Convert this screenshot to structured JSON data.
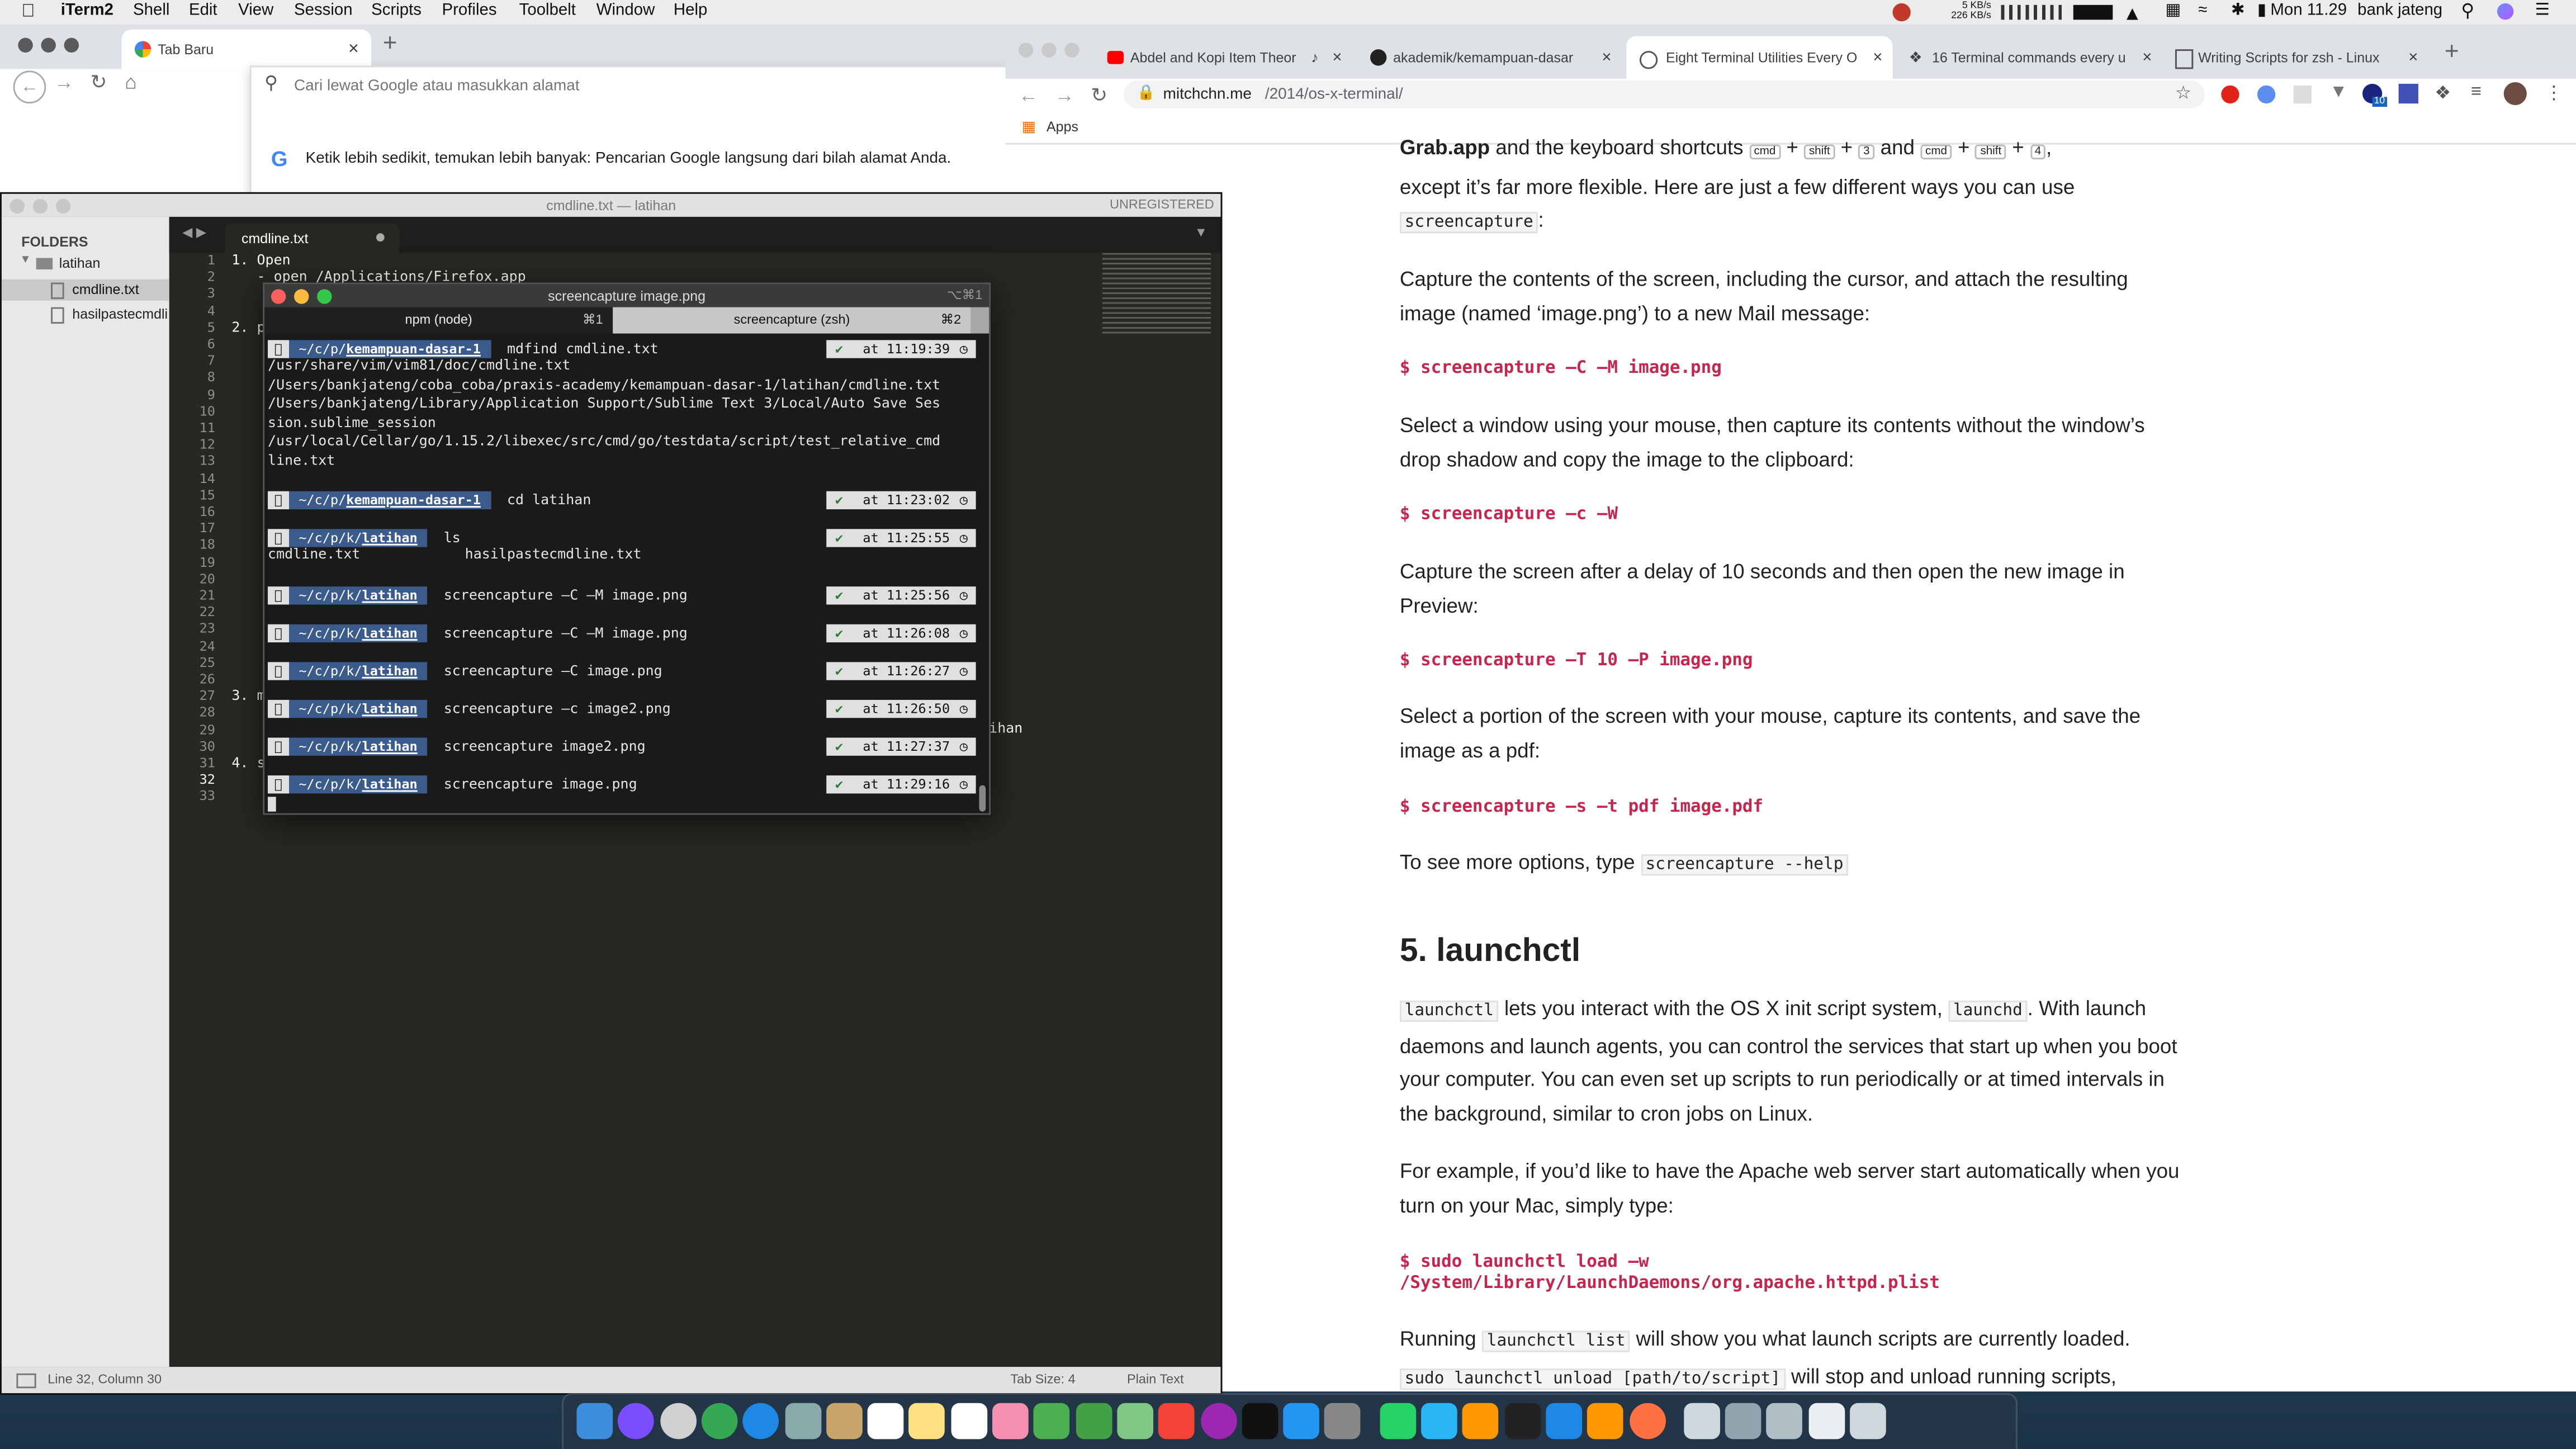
{
  "menubar": {
    "app": "iTerm2",
    "items": [
      "Shell",
      "Edit",
      "View",
      "Session",
      "Scripts",
      "Profiles",
      "Toolbelt",
      "Window",
      "Help"
    ],
    "net_up": "5 KB/s",
    "net_down": "226 KB/s",
    "clock": "Mon 11.29",
    "user": "bank jateng"
  },
  "browser_left": {
    "tab_title": "Tab Baru",
    "omnibox_placeholder": "Cari lewat Google atau masukkan alamat",
    "suggestion_text": "Ketik lebih sedikit, temukan lebih banyak: Pencarian Google langsung dari bilah alamat Anda."
  },
  "browser_right": {
    "tabs": [
      "Abdel and Kopi Item Theor",
      "akademik/kemampuan-dasar",
      "Eight Terminal Utilities Every O",
      "16 Terminal commands every u",
      "Writing Scripts for zsh - Linux"
    ],
    "url_domain": "mitchchn.me",
    "url_path": "/2014/os-x-terminal/",
    "bookmark_apps": "Apps",
    "ext_badge": "10"
  },
  "article": {
    "p1_lead": "Grab.app",
    "p1_mid": " and the keyboard shortcuts ",
    "k_cmd": "cmd",
    "k_shift": "shift",
    "k_3": "3",
    "and": "and",
    "k_4": "4",
    "p1_rest": "except it’s far more flexible. Here are just a few different ways you can use",
    "p1_code": "screencapture",
    "p1_end": ":",
    "p2": "Capture the contents of the screen, including the cursor, and attach the resulting image (named ‘image.png’) to a new Mail message:",
    "c1": "$ screencapture –C –M image.png",
    "p3": "Select a window using your mouse, then capture its contents without the window’s drop shadow and copy the image to the clipboard:",
    "c2": "$ screencapture –c –W",
    "p4": "Capture the screen after a delay of 10 seconds and then open the new image in Preview:",
    "c3": "$ screencapture –T 10 –P image.png",
    "p5": "Select a portion of the screen with your mouse, capture its contents, and save the image as a pdf:",
    "c4": "$ screencapture –s –t pdf image.pdf",
    "p6": "To see more options, type ",
    "p6_code": "screencapture --help",
    "h2": "5. launchctl",
    "p7_code1": "launchctl",
    "p7_a": " lets you interact with the OS X init script system, ",
    "p7_code2": "launchd",
    "p7_b": ". With launch daemons and launch agents, you can control the services that start up when you boot your computer. You can even set up scripts to run periodically or at timed intervals in the background, similar to cron jobs on Linux.",
    "p8": "For example, if you’d like to have the Apache web server start automatically when you turn on your Mac, simply type:",
    "c5a": "$ sudo launchctl load –w",
    "c5b": "/System/Library/LaunchDaemons/org.apache.httpd.plist",
    "p9_a": "Running ",
    "p9_code1": "launchctl list",
    "p9_b": " will show you what launch scripts are currently loaded.",
    "p9_code2": "sudo launchctl unload [path/to/script]",
    "p9_c": " will stop and unload running scripts,"
  },
  "sublime": {
    "title": "cmdline.txt — latihan",
    "unregistered": "UNREGISTERED",
    "folders_label": "FOLDERS",
    "folder": "latihan",
    "files": [
      "cmdline.txt",
      "hasilpastecmdli"
    ],
    "tab": "cmdline.txt",
    "line_numbers": [
      "1",
      "2",
      "3",
      "4",
      "5",
      "6",
      "7",
      "8",
      "9",
      "10",
      "11",
      "12",
      "13",
      "14",
      "15",
      "16",
      "17",
      "18",
      "19",
      "20",
      "21",
      "22",
      "23",
      "24",
      "25",
      "26",
      "27",
      "28",
      "29",
      "30",
      "31",
      "32",
      "33"
    ],
    "line1": "1. Open",
    "line2": "   - open /Applications/Firefox.app",
    "line5": "2. p",
    "line27": "3. m",
    "line31": "4. s",
    "line29_tail": "ihan",
    "status_left": "Line 32, Column 30",
    "tab_size": "Tab Size: 4",
    "syntax": "Plain Text"
  },
  "iterm": {
    "title": "screencapture image.png",
    "title_shortcut": "⌥⌘1",
    "tab1": "npm (node)",
    "tab1_key": "⌘1",
    "tab2": "screencapture (zsh)",
    "tab2_key": "⌘2",
    "prompts": [
      {
        "path_a": "~/c/p/",
        "path_b": "kemampuan-dasar-1",
        "cmd": "mdfind cmdline.txt",
        "time": "at 11:19:39"
      },
      {
        "path_a": "~/c/p/",
        "path_b": "kemampuan-dasar-1",
        "cmd": "cd latihan",
        "time": "at 11:23:02"
      },
      {
        "path_a": "~/c/p/k/",
        "path_b": "latihan",
        "cmd": "ls",
        "time": "at 11:25:55"
      },
      {
        "path_a": "~/c/p/k/",
        "path_b": "latihan",
        "cmd": "screencapture –C –M image.png",
        "time": "at 11:25:56"
      },
      {
        "path_a": "~/c/p/k/",
        "path_b": "latihan",
        "cmd": "screencapture –C –M image.png",
        "time": "at 11:26:08"
      },
      {
        "path_a": "~/c/p/k/",
        "path_b": "latihan",
        "cmd": "screencapture –C  image.png",
        "time": "at 11:26:27"
      },
      {
        "path_a": "~/c/p/k/",
        "path_b": "latihan",
        "cmd": "screencapture –c  image2.png",
        "time": "at 11:26:50"
      },
      {
        "path_a": "~/c/p/k/",
        "path_b": "latihan",
        "cmd": "screencapture   image2.png",
        "time": "at 11:27:37"
      },
      {
        "path_a": "~/c/p/k/",
        "path_b": "latihan",
        "cmd": "screencapture   image.png",
        "time": "at 11:29:16"
      }
    ],
    "out_mdfind": [
      "/usr/share/vim/vim81/doc/cmdline.txt",
      "/Users/bankjateng/coba_coba/praxis-academy/kemampuan-dasar-1/latihan/cmdline.txt",
      "/Users/bankjateng/Library/Application Support/Sublime Text 3/Local/Auto Save Ses",
      "sion.sublime_session",
      "/usr/local/Cellar/go/1.15.2/libexec/src/cmd/go/testdata/script/test_relative_cmd",
      "line.txt"
    ],
    "out_ls_1": "cmdline.txt",
    "out_ls_2": "hasilpastecmdline.txt",
    "check": "✔"
  },
  "colors": {
    "accent": "#1a73e8",
    "cmd_red": "#c7254e",
    "prompt_blue": "#3b5b8c"
  }
}
